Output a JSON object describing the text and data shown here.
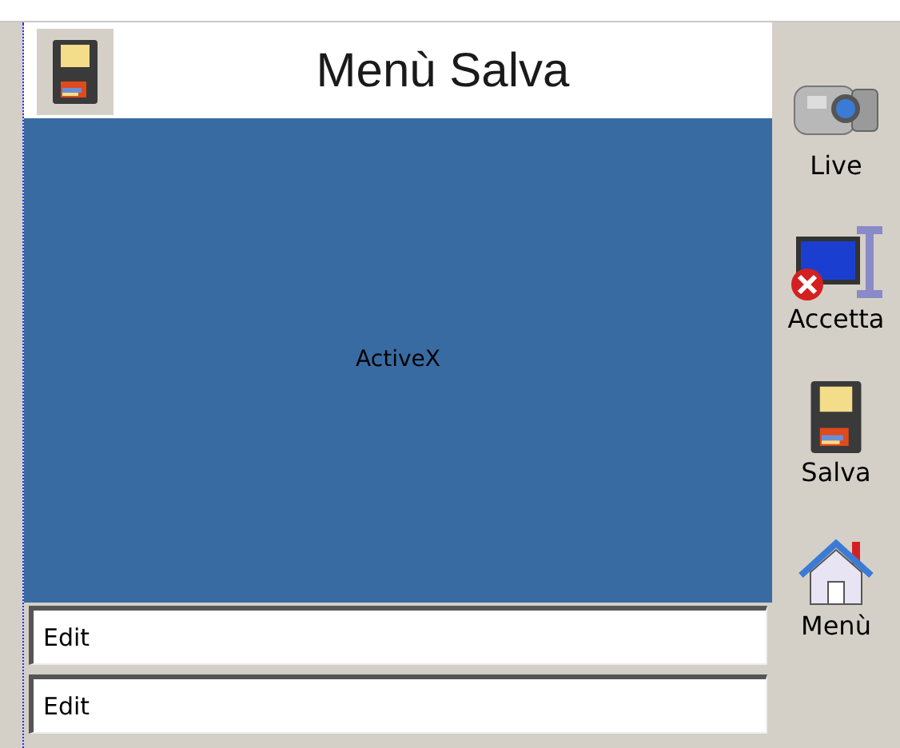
{
  "header": {
    "title": "Menù Salva"
  },
  "activex": {
    "label": "ActiveX"
  },
  "fields": [
    {
      "value": "Edit"
    },
    {
      "value": "Edit"
    }
  ],
  "sidebar": {
    "items": [
      {
        "kind": "camera",
        "label": "Live"
      },
      {
        "kind": "monitor",
        "label": "Accetta"
      },
      {
        "kind": "disk",
        "label": "Salva"
      },
      {
        "kind": "home",
        "label": "Menù"
      }
    ]
  }
}
